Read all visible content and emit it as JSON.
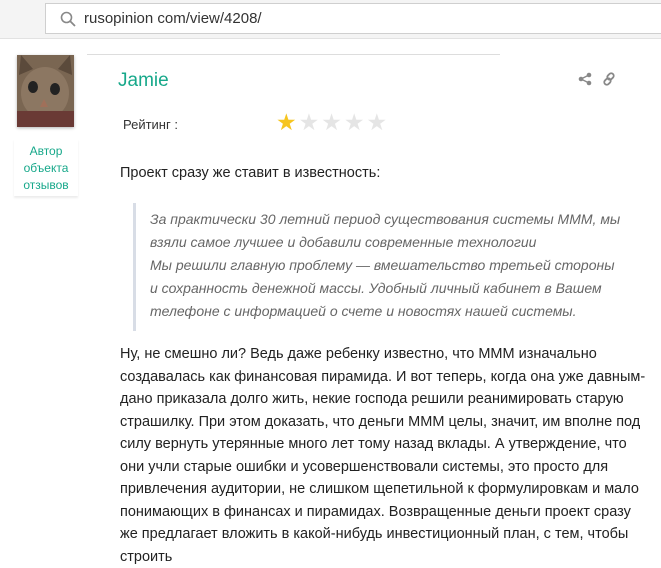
{
  "browser": {
    "url": "rusopinion com/view/4208/"
  },
  "author": {
    "name": "Jamie",
    "role": "Автор объекта отзывов"
  },
  "rating": {
    "label": "Рейтинг :",
    "value": 1,
    "max": 5
  },
  "review": {
    "lead": "Проект сразу же ставит в известность:",
    "quote": [
      "За практически 30 летний период существования системы МММ, мы",
      "взяли самое лучшее и добавили современные технологии",
      "Мы решили главную проблему — вмешательство третьей стороны",
      "и сохранность денежной массы. Удобный личный кабинет в Вашем",
      "телефоне с информацией о счете и новостях нашей системы."
    ],
    "body": "Ну, не смешно ли? Ведь даже ребенку известно, что МММ изначально создавалась как финансовая пирамида. И вот теперь, когда она уже давным-дано приказала долго жить, некие господа решили реанимировать старую страшилку. При этом доказать, что деньги МММ целы, значит, им вполне под силу вернуть утерянные много лет тому назад вклады. А утверждение, что они учли старые ошибки и усовершенствовали системы, это просто для привлечения аудитории, не слишком щепетильной к формулировкам и мало понимающих в финансах и пирамидах. Возвращенные деньги проект сразу же предлагает вложить в какой-нибудь инвестиционный план, с тем, чтобы строить"
  },
  "colors": {
    "accent": "#17a88a",
    "star": "#f6c520"
  }
}
